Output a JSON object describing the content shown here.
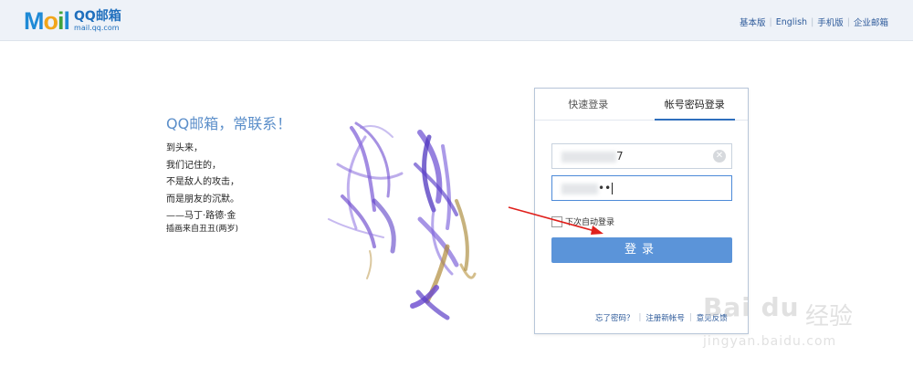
{
  "header": {
    "logo_qq": "QQ邮箱",
    "logo_url": "mail.qq.com",
    "links": [
      "基本版",
      "English",
      "手机版",
      "企业邮箱"
    ]
  },
  "promo": {
    "slogan": "QQ邮箱，常联系！",
    "poem": [
      "到头来，",
      "我们记住的，",
      "不是敌人的攻击，",
      "而是朋友的沉默。",
      "——马丁·路德·金"
    ],
    "credit": "插画来自丑丑(两岁)"
  },
  "login": {
    "tabs": [
      {
        "label": "快速登录",
        "active": false
      },
      {
        "label": "帐号密码登录",
        "active": true
      }
    ],
    "username_suffix": "7",
    "password_suffix": "••",
    "auto_login_label": "下次自动登录",
    "auto_login_checked": false,
    "submit_label": "登录",
    "links": [
      "忘了密码？",
      "注册新帐号",
      "意见反馈"
    ]
  },
  "watermark": {
    "brand": "Bai du",
    "brand_cn": "经验",
    "url": "jingyan.baidu.com"
  },
  "colors": {
    "accent": "#5b94d9",
    "link": "#2d5a9a",
    "slogan": "#5c8fca",
    "annotation_arrow": "#e0201c"
  }
}
